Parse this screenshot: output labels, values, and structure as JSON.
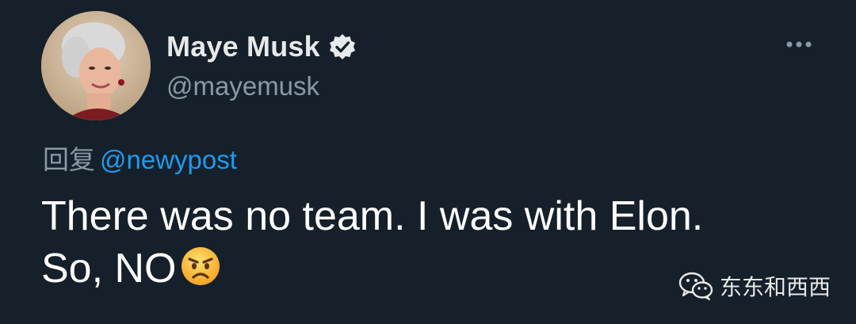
{
  "author": {
    "display_name": "Maye Musk",
    "handle": "@mayemusk",
    "verified": true
  },
  "reply": {
    "prefix": "回复",
    "to_handle": "@newypost"
  },
  "tweet": {
    "line1": "There was no team. I was with Elon.",
    "line2": "So, NO",
    "emoji": "angry-face"
  },
  "watermark": {
    "text": "东东和西西",
    "icon": "wechat-icon"
  },
  "icons": {
    "verified": "verified-badge-icon",
    "more": "more-options-icon"
  },
  "colors": {
    "background": "#15202b",
    "link": "#1d9bf0",
    "secondary_text": "#8b98a5",
    "primary_text": "#ffffff"
  }
}
